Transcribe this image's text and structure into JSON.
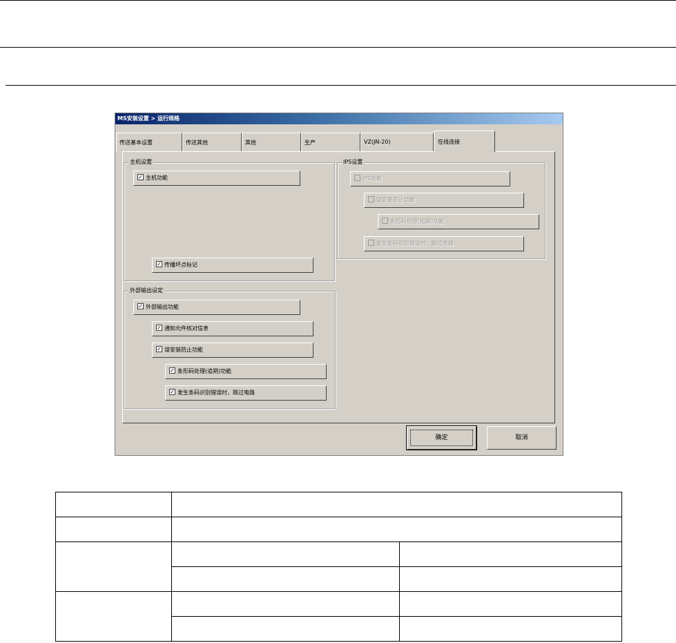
{
  "dialog": {
    "title_prefix": "MS",
    "title": "安装设置 > 运行规格",
    "tabs": [
      {
        "label": "传送基本设置"
      },
      {
        "label": "传送其他"
      },
      {
        "label": "其他"
      },
      {
        "label": "生产"
      },
      {
        "label": "VZ(JN-20)"
      },
      {
        "label": "在线连接",
        "active": true
      }
    ],
    "host_group": {
      "label": "主机设置",
      "host_function": {
        "label": "主机功能",
        "checked": true
      },
      "skip_bad_mark": {
        "label": "传播坏点标记",
        "checked": true
      }
    },
    "external_group": {
      "label": "外部输出设定",
      "external_output": {
        "label": "外部输出功能",
        "checked": true
      },
      "notify_parts_info": {
        "label": "通知元件核对信息",
        "checked": true
      },
      "misplace_prevent": {
        "label": "误安装防止功能",
        "checked": true
      },
      "barcode_process": {
        "label": "条形码处理(追朔)功能",
        "checked": true
      },
      "barcode_error_bypass": {
        "label": "发生条码识别错误时，跳过电路",
        "checked": true
      }
    },
    "ips_group": {
      "label": "IPS设置",
      "ips_function": {
        "label": "IPS功能",
        "checked": false,
        "enabled": false
      },
      "misplace_prevent": {
        "label": "误安装防止功能",
        "checked": false,
        "enabled": false
      },
      "barcode_process": {
        "label": "条形码处理(追朔)功能",
        "checked": false,
        "enabled": false
      },
      "barcode_error_bypass": {
        "label": "发生条码识别错误时，跳过电路",
        "checked": false,
        "enabled": false
      }
    },
    "buttons": {
      "ok": "确定",
      "cancel": "取消"
    }
  },
  "check_mark": "✓"
}
